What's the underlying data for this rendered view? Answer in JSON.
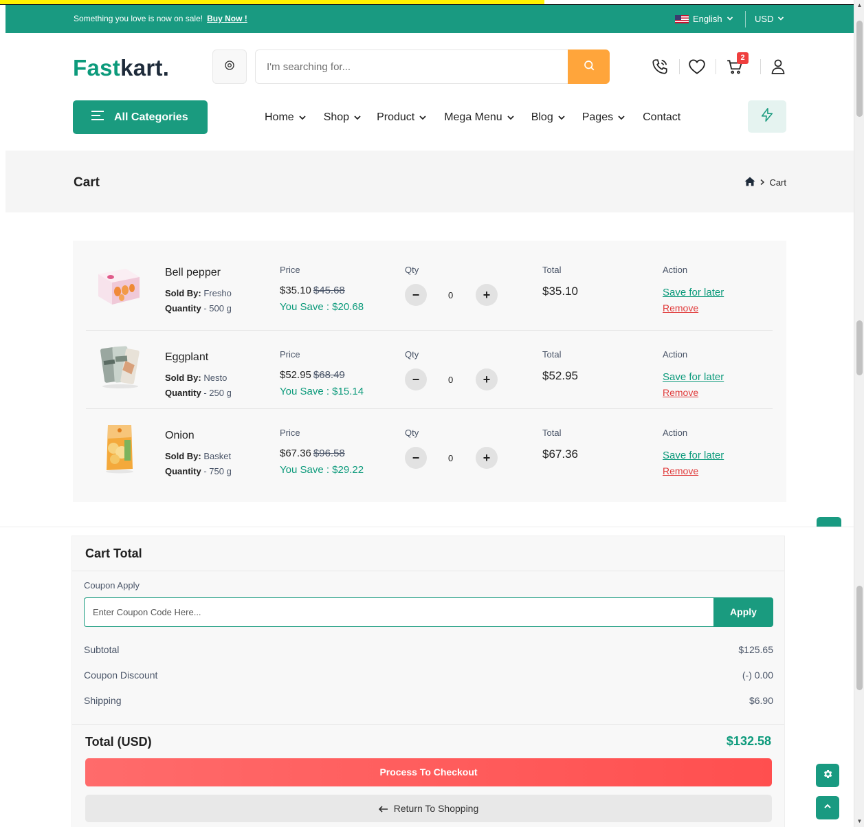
{
  "topbar": {
    "notice": "Something you love is now on sale!",
    "notice_link": "Buy Now !",
    "language": "English",
    "currency": "USD"
  },
  "header": {
    "logo_part1": "Fast",
    "logo_part2": "kart.",
    "search_placeholder": "I'm searching for...",
    "cart_count": "2"
  },
  "nav": {
    "all_categories": "All Categories",
    "items": [
      {
        "label": "Home"
      },
      {
        "label": "Shop"
      },
      {
        "label": "Product"
      },
      {
        "label": "Mega Menu"
      },
      {
        "label": "Blog"
      },
      {
        "label": "Pages"
      },
      {
        "label": "Contact"
      }
    ]
  },
  "breadcrumb": {
    "title": "Cart",
    "current": "Cart"
  },
  "cart": {
    "col_price": "Price",
    "col_qty": "Qty",
    "col_total": "Total",
    "col_action": "Action",
    "sold_by_label": "Sold By:",
    "quantity_label": "Quantity",
    "save_for_later": "Save for later",
    "remove": "Remove",
    "items": [
      {
        "name": "Bell pepper",
        "seller": "Fresho",
        "quantity": "500 g",
        "price": "$35.10",
        "old_price": "$45.68",
        "you_save": "You Save : $20.68",
        "qty": "0",
        "total": "$35.10"
      },
      {
        "name": "Eggplant",
        "seller": "Nesto",
        "quantity": "250 g",
        "price": "$52.95",
        "old_price": "$68.49",
        "you_save": "You Save : $15.14",
        "qty": "0",
        "total": "$52.95"
      },
      {
        "name": "Onion",
        "seller": "Basket",
        "quantity": "750 g",
        "price": "$67.36",
        "old_price": "$96.58",
        "you_save": "You Save : $29.22",
        "qty": "0",
        "total": "$67.36"
      }
    ]
  },
  "cart_total": {
    "title": "Cart Total",
    "coupon_label": "Coupon Apply",
    "coupon_placeholder": "Enter Coupon Code Here...",
    "apply": "Apply",
    "subtotal_label": "Subtotal",
    "subtotal": "$125.65",
    "discount_label": "Coupon Discount",
    "discount": "(-) 0.00",
    "shipping_label": "Shipping",
    "shipping": "$6.90",
    "total_label": "Total (USD)",
    "total": "$132.58",
    "checkout": "Process To Checkout",
    "return": "Return To Shopping"
  },
  "icons": {
    "location": "location-pin-icon",
    "search": "search-icon",
    "phone": "phone-icon",
    "wishlist": "heart-icon",
    "cart": "cart-icon",
    "user": "user-icon",
    "menu": "menu-lines-icon",
    "flash": "zap-icon",
    "home": "home-icon",
    "settings": "gear-icon",
    "scroll_top": "chevron-up-icon"
  },
  "colors": {
    "brand": "#199a81",
    "search_button": "#ffa53b",
    "checkout": "#ff5a5a",
    "remove": "#e03a3a",
    "badge": "#ef3f3e"
  }
}
